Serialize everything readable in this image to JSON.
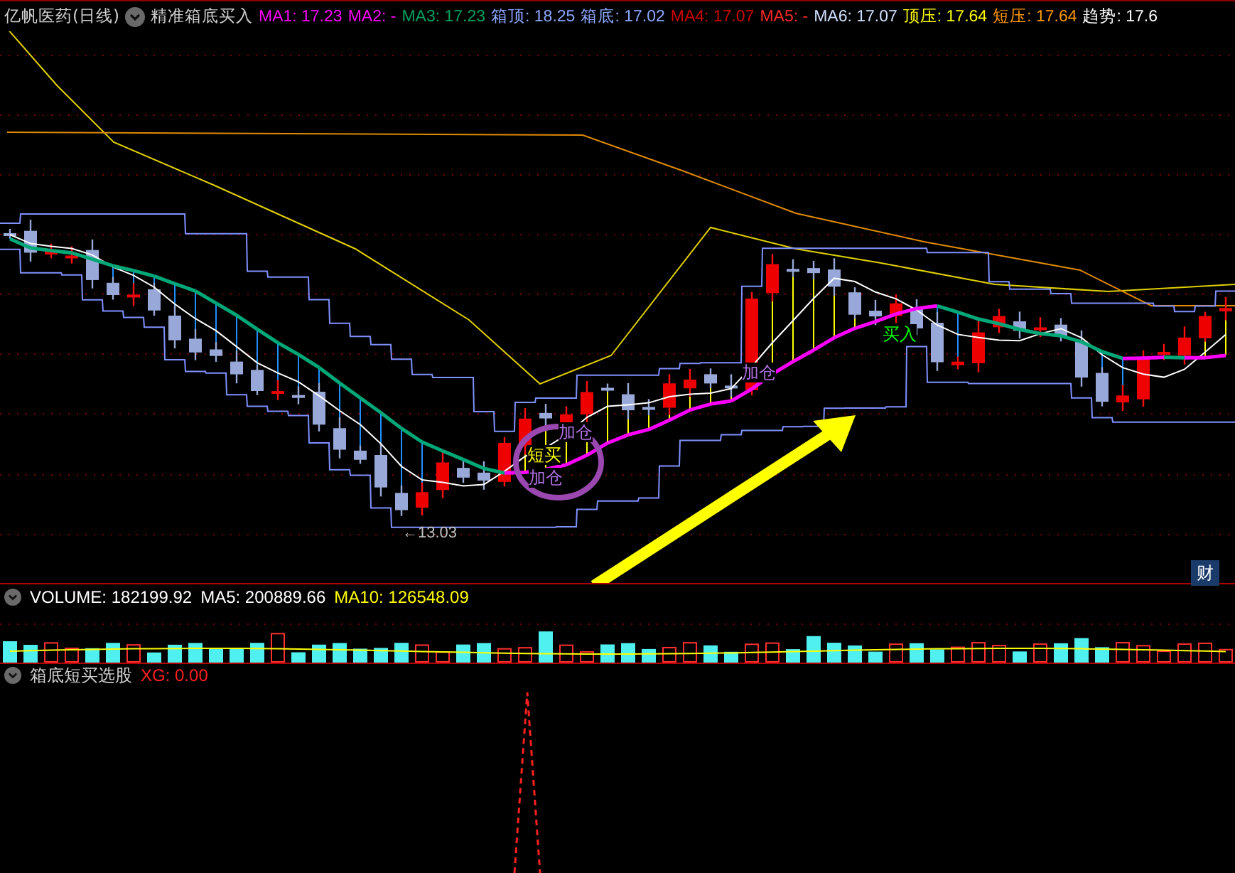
{
  "header": {
    "title": "亿帆医药(日线)",
    "indicator_name": "精准箱底买入",
    "values": [
      {
        "label": "MA1:",
        "value": "17.23",
        "color": "#ff00ff"
      },
      {
        "label": "MA2:",
        "value": "-",
        "color": "#ff00ff"
      },
      {
        "label": "MA3:",
        "value": "17.23",
        "color": "#00a060"
      },
      {
        "label": "箱顶:",
        "value": "18.25",
        "color": "#8ea8ff"
      },
      {
        "label": "箱底:",
        "value": "17.02",
        "color": "#8ea8ff"
      },
      {
        "label": "MA4:",
        "value": "17.07",
        "color": "#d00000"
      },
      {
        "label": "MA5:",
        "value": "-",
        "color": "#ff2a2a"
      },
      {
        "label": "MA6:",
        "value": "17.07",
        "color": "#d0e0ff"
      },
      {
        "label": "顶压:",
        "value": "17.64",
        "color": "#ffff00"
      },
      {
        "label": "短压:",
        "value": "17.64",
        "color": "#ff9900"
      },
      {
        "label": "趋势:",
        "value": "17.6",
        "color": "#ffffff"
      }
    ]
  },
  "price_chart": {
    "low_label": "←13.03",
    "signals": [
      {
        "text": "加仓",
        "color": "#b070e0"
      },
      {
        "text": "加仓",
        "color": "#b070e0"
      },
      {
        "text": "加仓",
        "color": "#b070e0"
      },
      {
        "text": "短买",
        "color": "#ffff00"
      },
      {
        "text": "买入",
        "color": "#00ff00"
      }
    ],
    "finance_button": "财"
  },
  "volume": {
    "values": [
      {
        "label": "VOLUME:",
        "value": "182199.92",
        "color": "#ffffff"
      },
      {
        "label": "MA5:",
        "value": "200889.66",
        "color": "#ffffff"
      },
      {
        "label": "MA10:",
        "value": "126548.09",
        "color": "#ffff00"
      }
    ]
  },
  "indicator": {
    "title": "箱底短买选股",
    "values": [
      {
        "label": "XG:",
        "value": "0.00",
        "color": "#ff2020"
      }
    ]
  }
}
